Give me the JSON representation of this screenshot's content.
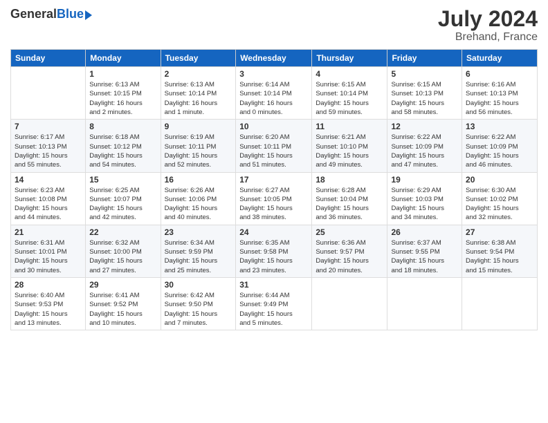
{
  "header": {
    "logo_general": "General",
    "logo_blue": "Blue",
    "month": "July 2024",
    "location": "Brehand, France"
  },
  "days_of_week": [
    "Sunday",
    "Monday",
    "Tuesday",
    "Wednesday",
    "Thursday",
    "Friday",
    "Saturday"
  ],
  "weeks": [
    [
      {
        "day": "",
        "info": ""
      },
      {
        "day": "1",
        "info": "Sunrise: 6:13 AM\nSunset: 10:15 PM\nDaylight: 16 hours\nand 2 minutes."
      },
      {
        "day": "2",
        "info": "Sunrise: 6:13 AM\nSunset: 10:14 PM\nDaylight: 16 hours\nand 1 minute."
      },
      {
        "day": "3",
        "info": "Sunrise: 6:14 AM\nSunset: 10:14 PM\nDaylight: 16 hours\nand 0 minutes."
      },
      {
        "day": "4",
        "info": "Sunrise: 6:15 AM\nSunset: 10:14 PM\nDaylight: 15 hours\nand 59 minutes."
      },
      {
        "day": "5",
        "info": "Sunrise: 6:15 AM\nSunset: 10:13 PM\nDaylight: 15 hours\nand 58 minutes."
      },
      {
        "day": "6",
        "info": "Sunrise: 6:16 AM\nSunset: 10:13 PM\nDaylight: 15 hours\nand 56 minutes."
      }
    ],
    [
      {
        "day": "7",
        "info": "Sunrise: 6:17 AM\nSunset: 10:13 PM\nDaylight: 15 hours\nand 55 minutes."
      },
      {
        "day": "8",
        "info": "Sunrise: 6:18 AM\nSunset: 10:12 PM\nDaylight: 15 hours\nand 54 minutes."
      },
      {
        "day": "9",
        "info": "Sunrise: 6:19 AM\nSunset: 10:11 PM\nDaylight: 15 hours\nand 52 minutes."
      },
      {
        "day": "10",
        "info": "Sunrise: 6:20 AM\nSunset: 10:11 PM\nDaylight: 15 hours\nand 51 minutes."
      },
      {
        "day": "11",
        "info": "Sunrise: 6:21 AM\nSunset: 10:10 PM\nDaylight: 15 hours\nand 49 minutes."
      },
      {
        "day": "12",
        "info": "Sunrise: 6:22 AM\nSunset: 10:09 PM\nDaylight: 15 hours\nand 47 minutes."
      },
      {
        "day": "13",
        "info": "Sunrise: 6:22 AM\nSunset: 10:09 PM\nDaylight: 15 hours\nand 46 minutes."
      }
    ],
    [
      {
        "day": "14",
        "info": "Sunrise: 6:23 AM\nSunset: 10:08 PM\nDaylight: 15 hours\nand 44 minutes."
      },
      {
        "day": "15",
        "info": "Sunrise: 6:25 AM\nSunset: 10:07 PM\nDaylight: 15 hours\nand 42 minutes."
      },
      {
        "day": "16",
        "info": "Sunrise: 6:26 AM\nSunset: 10:06 PM\nDaylight: 15 hours\nand 40 minutes."
      },
      {
        "day": "17",
        "info": "Sunrise: 6:27 AM\nSunset: 10:05 PM\nDaylight: 15 hours\nand 38 minutes."
      },
      {
        "day": "18",
        "info": "Sunrise: 6:28 AM\nSunset: 10:04 PM\nDaylight: 15 hours\nand 36 minutes."
      },
      {
        "day": "19",
        "info": "Sunrise: 6:29 AM\nSunset: 10:03 PM\nDaylight: 15 hours\nand 34 minutes."
      },
      {
        "day": "20",
        "info": "Sunrise: 6:30 AM\nSunset: 10:02 PM\nDaylight: 15 hours\nand 32 minutes."
      }
    ],
    [
      {
        "day": "21",
        "info": "Sunrise: 6:31 AM\nSunset: 10:01 PM\nDaylight: 15 hours\nand 30 minutes."
      },
      {
        "day": "22",
        "info": "Sunrise: 6:32 AM\nSunset: 10:00 PM\nDaylight: 15 hours\nand 27 minutes."
      },
      {
        "day": "23",
        "info": "Sunrise: 6:34 AM\nSunset: 9:59 PM\nDaylight: 15 hours\nand 25 minutes."
      },
      {
        "day": "24",
        "info": "Sunrise: 6:35 AM\nSunset: 9:58 PM\nDaylight: 15 hours\nand 23 minutes."
      },
      {
        "day": "25",
        "info": "Sunrise: 6:36 AM\nSunset: 9:57 PM\nDaylight: 15 hours\nand 20 minutes."
      },
      {
        "day": "26",
        "info": "Sunrise: 6:37 AM\nSunset: 9:55 PM\nDaylight: 15 hours\nand 18 minutes."
      },
      {
        "day": "27",
        "info": "Sunrise: 6:38 AM\nSunset: 9:54 PM\nDaylight: 15 hours\nand 15 minutes."
      }
    ],
    [
      {
        "day": "28",
        "info": "Sunrise: 6:40 AM\nSunset: 9:53 PM\nDaylight: 15 hours\nand 13 minutes."
      },
      {
        "day": "29",
        "info": "Sunrise: 6:41 AM\nSunset: 9:52 PM\nDaylight: 15 hours\nand 10 minutes."
      },
      {
        "day": "30",
        "info": "Sunrise: 6:42 AM\nSunset: 9:50 PM\nDaylight: 15 hours\nand 7 minutes."
      },
      {
        "day": "31",
        "info": "Sunrise: 6:44 AM\nSunset: 9:49 PM\nDaylight: 15 hours\nand 5 minutes."
      },
      {
        "day": "",
        "info": ""
      },
      {
        "day": "",
        "info": ""
      },
      {
        "day": "",
        "info": ""
      }
    ]
  ]
}
